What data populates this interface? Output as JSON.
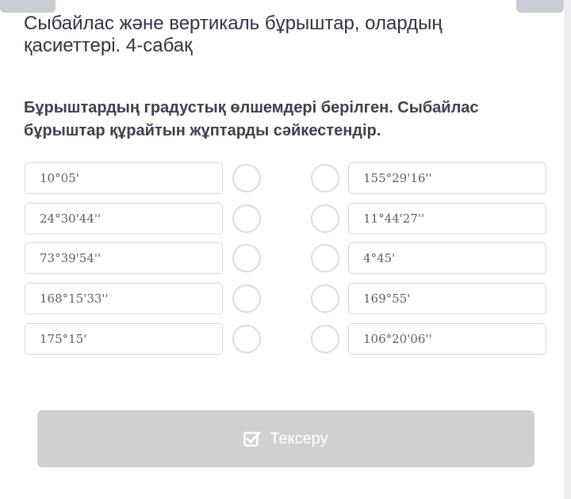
{
  "header": {
    "title": "Сыбайлас және вертикаль бұрыштар, олардың қасиеттері. 4-сабақ"
  },
  "question": {
    "text": "Бұрыштардың градустық өлшемдері берілген. Сыбайлас бұрыштар құрайтын жұптарды сәйкестендір."
  },
  "left_items": [
    "10°05'",
    "24°30'44''",
    "73°39'54''",
    "168°15'33''",
    "175°15'"
  ],
  "right_items": [
    "155°29'16''",
    "11°44'27''",
    "4°45'",
    "169°55'",
    "106°20'06''"
  ],
  "check_button": {
    "label": "Тексеру",
    "icon": "checkbox-check-icon",
    "state": "disabled"
  },
  "colors": {
    "title": "#2f3440",
    "card_border": "#d6d9de",
    "button_bg": "#d0d0d0",
    "radio_border": "#d9dce1"
  }
}
